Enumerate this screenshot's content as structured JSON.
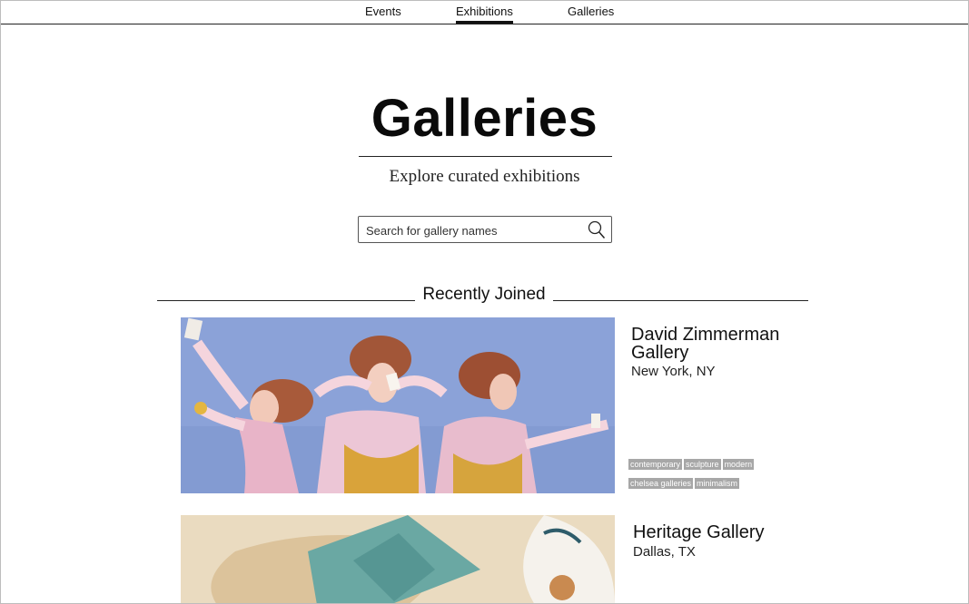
{
  "nav": {
    "items": [
      {
        "label": "Events",
        "active": false
      },
      {
        "label": "Exhibitions",
        "active": true
      },
      {
        "label": "Galleries",
        "active": false
      }
    ]
  },
  "hero": {
    "title": "Galleries",
    "subtitle": "Explore curated exhibitions"
  },
  "search": {
    "placeholder": "Search for gallery names",
    "icon": "search-icon"
  },
  "section": {
    "title": "Recently Joined"
  },
  "galleries": [
    {
      "name": "David Zimmerman Gallery",
      "location": "New York, NY",
      "tags": [
        "contemporary",
        "sculpture",
        "modern",
        "chelsea galleries",
        "minimalism"
      ]
    },
    {
      "name": "Heritage Gallery",
      "location": "Dallas, TX",
      "tags": []
    }
  ],
  "colors": {
    "tag_bg": "#a7a7a7",
    "card1_bg": "#8aa0d6",
    "card2_bg": "#e9dcc4"
  }
}
